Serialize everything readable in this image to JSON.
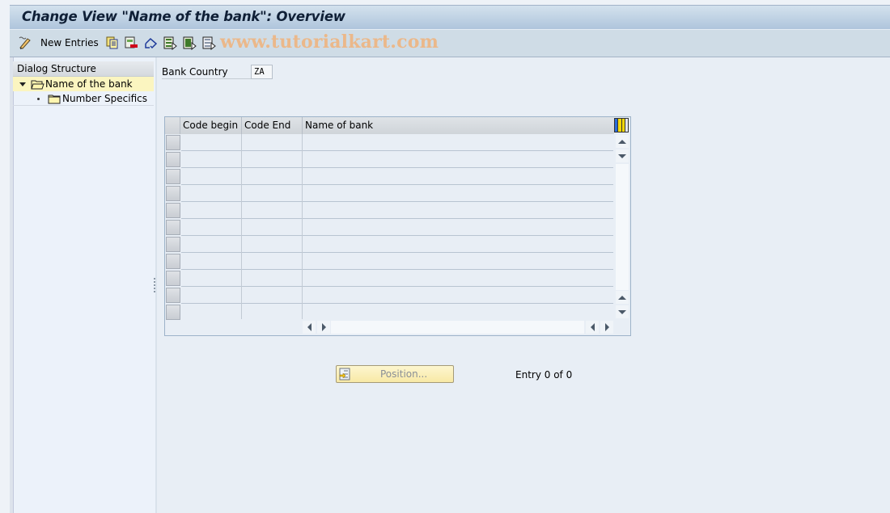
{
  "window": {
    "title": "Change View \"Name of the bank\": Overview"
  },
  "toolbar": {
    "items": [
      {
        "icon": "display-change-icon",
        "label": ""
      },
      {
        "icon": "new-entries-icon",
        "label": "New Entries"
      },
      {
        "icon": "copy-as-icon",
        "label": ""
      },
      {
        "icon": "delete-icon",
        "label": ""
      },
      {
        "icon": "undo-change-icon",
        "label": ""
      },
      {
        "icon": "select-all-icon",
        "label": ""
      },
      {
        "icon": "select-block-icon",
        "label": ""
      },
      {
        "icon": "deselect-all-icon",
        "label": ""
      }
    ],
    "new_entries_label": "New Entries",
    "watermark": "www.tutorialkart.com"
  },
  "dialog_structure": {
    "header": "Dialog Structure",
    "items": [
      {
        "label": "Name of the bank",
        "expanded": true,
        "selected": true,
        "level": 0
      },
      {
        "label": "Number Specifics",
        "expanded": false,
        "selected": false,
        "level": 1
      }
    ]
  },
  "filter": {
    "bank_country_label": "Bank Country",
    "bank_country_value": "ZA"
  },
  "table": {
    "columns": [
      "Code begin",
      "Code End",
      "Name of bank"
    ],
    "rows": [
      [
        "",
        "",
        ""
      ],
      [
        "",
        "",
        ""
      ],
      [
        "",
        "",
        ""
      ],
      [
        "",
        "",
        ""
      ],
      [
        "",
        "",
        ""
      ],
      [
        "",
        "",
        ""
      ],
      [
        "",
        "",
        ""
      ],
      [
        "",
        "",
        ""
      ],
      [
        "",
        "",
        ""
      ],
      [
        "",
        "",
        ""
      ],
      [
        "",
        "",
        ""
      ]
    ]
  },
  "footer": {
    "position_button_label": "Position...",
    "entry_text": "Entry 0 of 0"
  },
  "colors": {
    "selected_tree_item": "#fbf5c0",
    "watermark": "#f0b27a",
    "title_text": "#0f1f36"
  }
}
